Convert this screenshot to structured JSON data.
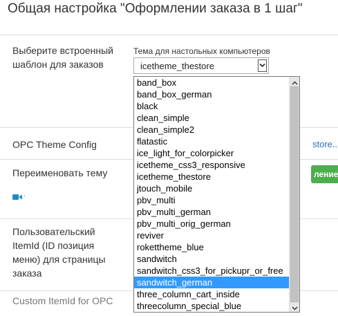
{
  "page": {
    "title": "Общая настройка \"Оформлении заказа в 1 шаг\""
  },
  "rows": {
    "template": {
      "label_line1": "Выберите встроенный",
      "label_line2": "шаблон для заказов"
    },
    "opc_theme_config": {
      "label": "OPC Theme Config",
      "link_text": "store..."
    },
    "rename_theme": {
      "label": "Переименовать тему",
      "button_text": "лением"
    },
    "custom_itemid": {
      "label_line1": "Пользовательский",
      "label_line2": "ItemId (ID позиция",
      "label_line3": "меню) для страницы",
      "label_line4": "заказа"
    },
    "custom_itemid_opc": {
      "label": "Custom ItemId for OPC"
    }
  },
  "theme_select": {
    "label": "Тема для настольных компьютеров",
    "selected": "icetheme_thestore",
    "options": [
      "band_box",
      "band_box_german",
      "black",
      "clean_simple",
      "clean_simple2",
      "flatastic",
      "ice_light_for_colorpicker",
      "icetheme_css3_responsive",
      "icetheme_thestore",
      "jtouch_mobile",
      "pbv_multi",
      "pbv_multi_german",
      "pbv_multi_orig_german",
      "reviver",
      "rokettheme_blue",
      "sandwitch",
      "sandwitch_css3_for_pickupr_or_free",
      "sandwitch_german",
      "three_column_cart_inside",
      "threecolumn_special_blue"
    ],
    "highlighted": "sandwitch_german"
  },
  "icons": {
    "video": "video-camera-icon",
    "dropdown_arrow": "chevron-down-icon"
  },
  "colors": {
    "highlight": "#3399ff",
    "link": "#2a6ebb",
    "button_green": "#4cae4c",
    "video_icon": "#1e8bc3"
  }
}
